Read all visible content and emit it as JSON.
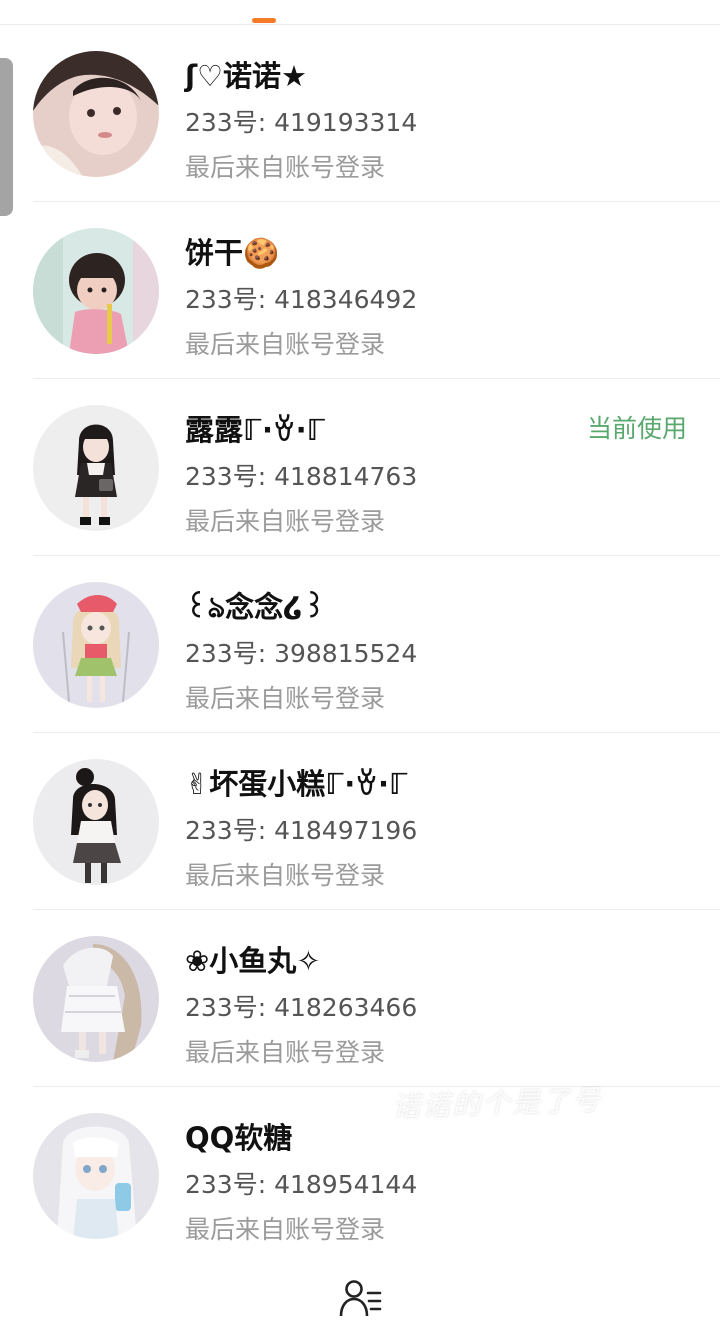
{
  "accounts": [
    {
      "name": "ʃ♡诺诺★",
      "uid": "233号: 419193314",
      "last_login": "最后来自账号登录"
    },
    {
      "name": "饼干🍪",
      "uid": "233号: 418346492",
      "last_login": "最后来自账号登录"
    },
    {
      "name": "露露ℾ·ꈊ·ℾ",
      "uid": "233号: 418814763",
      "last_login": "最后来自账号登录",
      "status": "当前使用"
    },
    {
      "name": "꒰ঌ念念໒꒱",
      "uid": "233号: 398815524",
      "last_login": "最后来自账号登录"
    },
    {
      "name": "✌坏蛋小糕ℾ·ꈊ·ℾ",
      "uid": "233号: 418497196",
      "last_login": "最后来自账号登录"
    },
    {
      "name": "❀小鱼丸✧",
      "uid": "233号: 418263466",
      "last_login": "最后来自账号登录"
    },
    {
      "name": "QQ软糖",
      "uid": "233号: 418954144",
      "last_login": "最后来自账号登录"
    }
  ],
  "watermark": "诺诺的个是了号",
  "icons": {
    "tab_indicator": "orange-tab-indicator",
    "bottom_action": "user-list-icon"
  },
  "colors": {
    "accent": "#f57c26",
    "current_status": "#5aa86e",
    "name_text": "#111111",
    "id_text": "#555555",
    "meta_text": "#9b9b9b"
  }
}
